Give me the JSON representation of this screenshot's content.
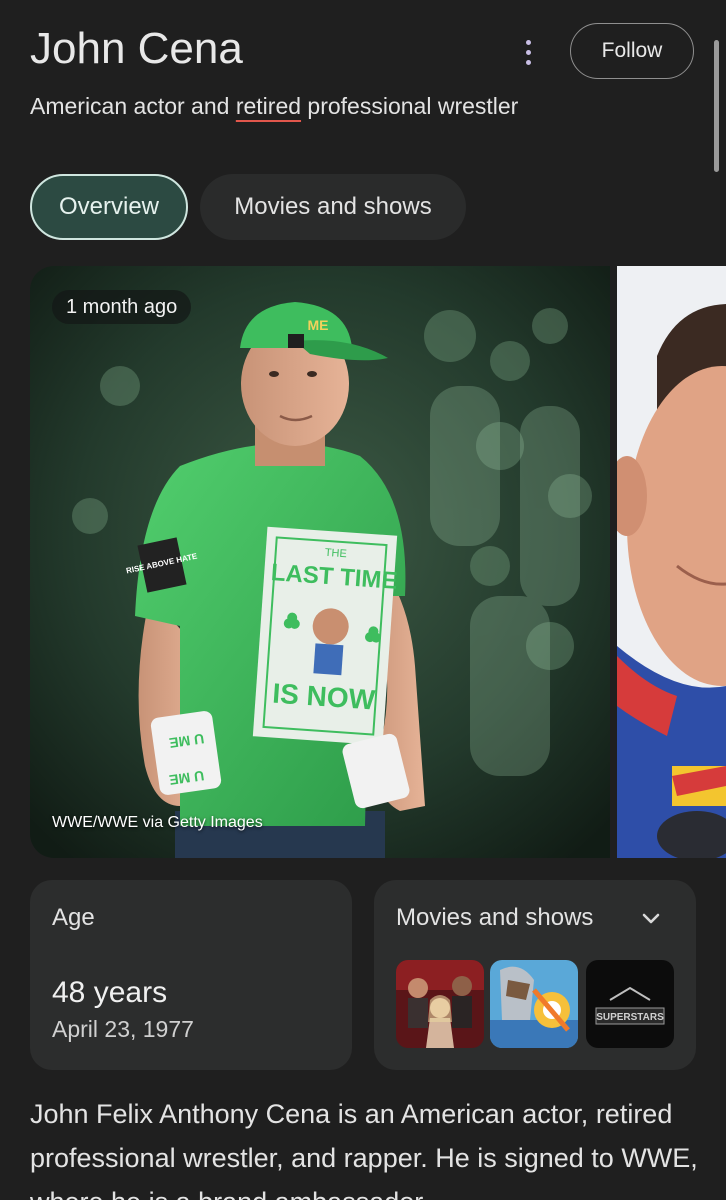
{
  "header": {
    "title": "John Cena",
    "subtitle_before": "American actor and ",
    "subtitle_underlined": "retired",
    "subtitle_after": " professional wrestler",
    "follow_label": "Follow",
    "more_icon": "more-vert-icon"
  },
  "tabs": [
    {
      "label": "Overview",
      "active": true
    },
    {
      "label": "Movies and shows",
      "active": false
    }
  ],
  "images": {
    "main": {
      "badge": "1 month ago",
      "credit": "WWE/WWE via Getty Images",
      "hat_text": "ME",
      "shirt_top": "THE",
      "shirt_line1": "LAST TIME",
      "shirt_line2": "IS NOW",
      "sleeve_patch": "RISE ABOVE HATE",
      "wristband_text": "U ME"
    }
  },
  "age_card": {
    "label": "Age",
    "value": "48 years",
    "date": "April 23, 1977"
  },
  "movies_card": {
    "label": "Movies and shows",
    "chevron_icon": "chevron-down-icon",
    "thumb3_text": "SUPERSTARS"
  },
  "description": "John Felix Anthony Cena is an American actor, retired professional wrestler, and rapper. He is signed to WWE, where he is a brand ambassador",
  "colors": {
    "background": "#1f1f1f",
    "active_tab_bg": "#2c4a42",
    "active_tab_border": "#cfe6df",
    "card_bg": "#2c2d2d",
    "underline_accent": "#e2574c",
    "shirt_green": "#3ebd5e"
  }
}
